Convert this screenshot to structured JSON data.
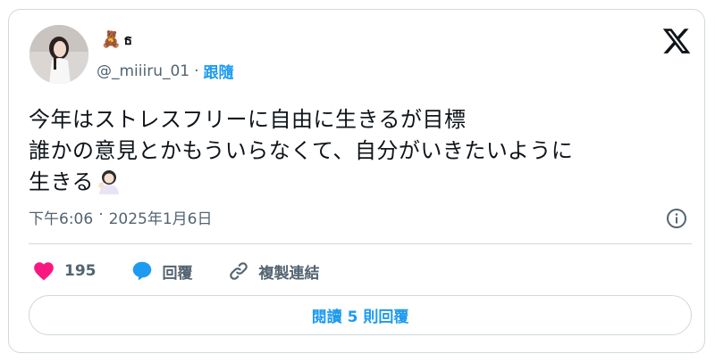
{
  "author": {
    "display_name_emoji": "🧸",
    "display_name": "ธ",
    "handle": "@_miiiru_01",
    "separator": "·",
    "follow_label": "跟隨"
  },
  "tweet": {
    "lines": [
      "今年はストレスフリーに自由に生きるが目標",
      "誰かの意見とかもういらなくて、自分がいきたいように",
      "生きる"
    ],
    "trailing_emoji": "woman-tipping-hand"
  },
  "meta": {
    "time": "下午6:06",
    "separator": "·",
    "date": "2025年1月6日"
  },
  "actions": {
    "like_count": "195",
    "reply_label": "回覆",
    "copy_link_label": "複製連結"
  },
  "read_replies_label": "閱讀 5 則回覆",
  "colors": {
    "accent": "#1d9bf0",
    "like": "#f91880",
    "muted": "#536471",
    "border": "#cfd9de"
  }
}
